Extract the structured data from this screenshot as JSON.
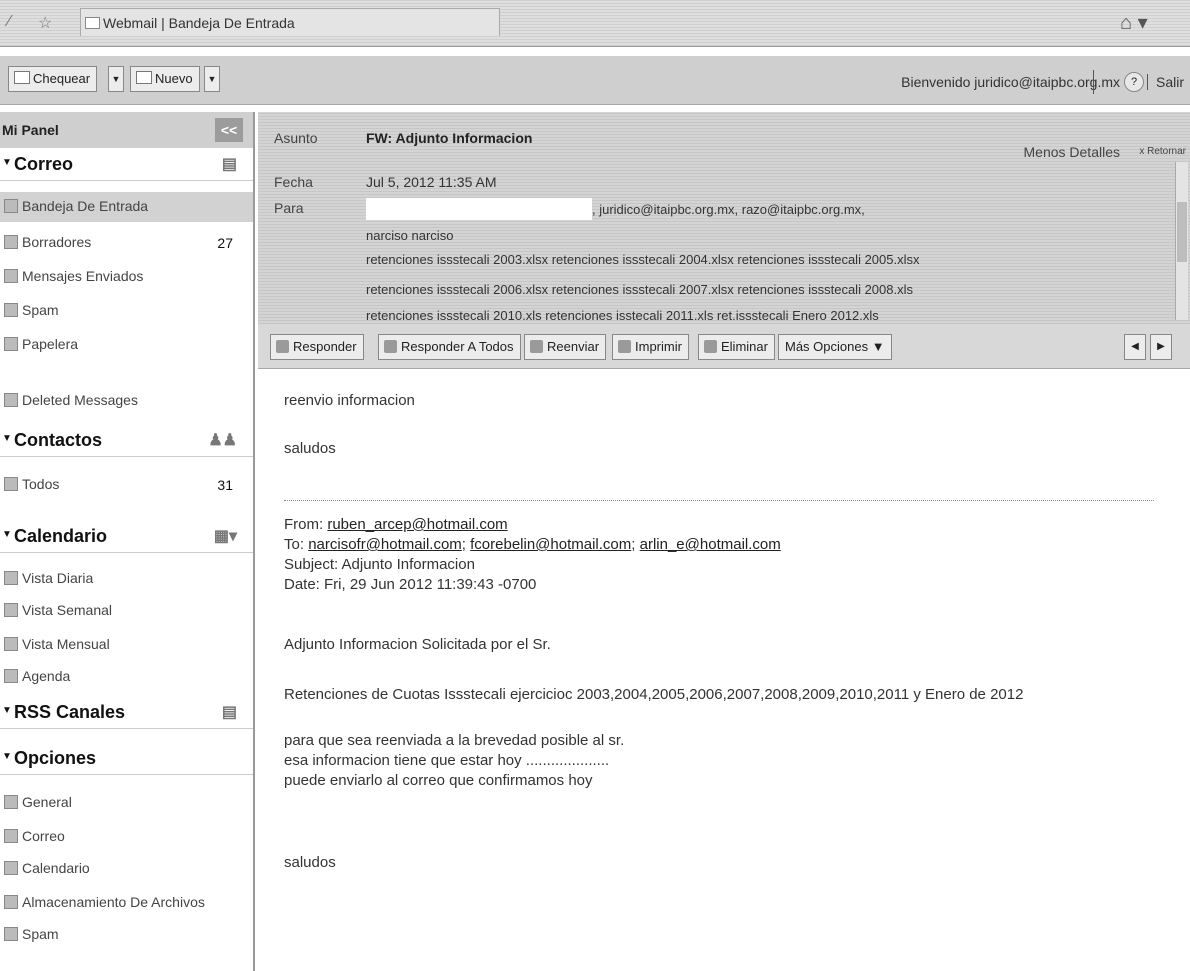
{
  "window": {
    "tab_title": "Webmail | Bandeja De Entrada"
  },
  "toolbar": {
    "check_label": "Chequear",
    "new_label": "Nuevo",
    "welcome": "Bienvenido juridico@itaipbc.org.mx",
    "help": "?",
    "logout": "Salir"
  },
  "sidebar": {
    "panel_title": "Mi Panel",
    "collapse": "<<",
    "mail": {
      "title": "Correo",
      "items": [
        {
          "label": "Bandeja De Entrada",
          "count": ""
        },
        {
          "label": "Borradores",
          "count": "27"
        },
        {
          "label": "Mensajes Enviados",
          "count": ""
        },
        {
          "label": "Spam",
          "count": ""
        },
        {
          "label": "Papelera",
          "count": ""
        },
        {
          "label": "Deleted Messages",
          "count": ""
        }
      ]
    },
    "contacts": {
      "title": "Contactos",
      "items": [
        {
          "label": "Todos",
          "count": "31"
        }
      ]
    },
    "calendar": {
      "title": "Calendario",
      "items": [
        {
          "label": "Vista Diaria"
        },
        {
          "label": "Vista Semanal"
        },
        {
          "label": "Vista Mensual"
        },
        {
          "label": "Agenda"
        }
      ]
    },
    "rss": {
      "title": "RSS Canales"
    },
    "options": {
      "title": "Opciones",
      "items": [
        {
          "label": "General"
        },
        {
          "label": "Correo"
        },
        {
          "label": "Calendario"
        },
        {
          "label": "Almacenamiento De Archivos"
        },
        {
          "label": "Spam"
        }
      ]
    }
  },
  "header": {
    "subject_label": "Asunto",
    "subject": "FW: Adjunto Informacion",
    "date_label": "Fecha",
    "date": "Jul 5, 2012 11:35 AM",
    "to_label": "Para",
    "to_rest": ", juridico@itaipbc.org.mx, razo@itaipbc.org.mx,",
    "to_line2": "narciso narciso",
    "attachments_row1": "retenciones issstecali 2003.xlsx   retenciones issstecali 2004.xlsx   retenciones issstecali 2005.xlsx",
    "attachments_row2": "retenciones issstecali 2006.xlsx   retenciones issstecali 2007.xlsx   retenciones issstecali 2008.xls",
    "attachments_row3": "retenciones issstecali 2010.xls   retenciones isstecali 2011.xls   ret.issstecali Enero 2012.xls",
    "less_details": "Menos Detalles",
    "return": "x Retornar"
  },
  "actions": {
    "reply": "Responder",
    "reply_all": "Responder A Todos",
    "forward": "Reenviar",
    "print": "Imprimir",
    "delete": "Eliminar",
    "more": "Más Opciones ▼"
  },
  "body": {
    "line1": "reenvio informacion",
    "line2": "saludos",
    "from_label": "From: ",
    "from": "ruben_arcep@hotmail.com",
    "to_label": "To: ",
    "to1": "narcisofr@hotmail.com",
    "to2": "fcorebelin@hotmail.com",
    "to3": "arlin_e@hotmail.com",
    "subject_line": "Subject: Adjunto Informacion",
    "date_line": "Date: Fri, 29 Jun 2012 11:39:43 -0700",
    "p1": "Adjunto Informacion Solicitada por el Sr.",
    "p2": "Retenciones de Cuotas Issstecali ejercicioc 2003,2004,2005,2006,2007,2008,2009,2010,2011 y Enero de 2012",
    "p3a": "para que sea reenviada a la brevedad posible al sr.",
    "p3b": "esa informacion tiene que estar hoy ....................",
    "p3c": "puede enviarlo al correo que confirmamos hoy",
    "closing": "saludos"
  }
}
